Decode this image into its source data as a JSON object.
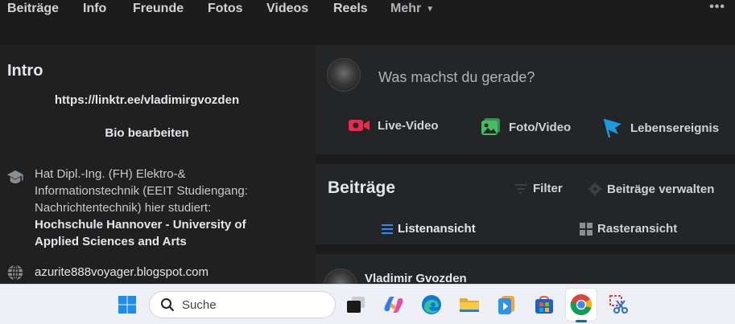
{
  "tabs": {
    "items": [
      "Beiträge",
      "Info",
      "Freunde",
      "Fotos",
      "Videos",
      "Reels"
    ],
    "more_label": "Mehr",
    "more_icon": "caret-down-icon",
    "options_icon": "more-options-icon"
  },
  "intro": {
    "title": "Intro",
    "link": "https://linktr.ee/vladimirgvozden",
    "edit_bio_label": "Bio bearbeiten",
    "education_prefix": "Hat Dipl.-Ing. (FH) Elektro-& Informationstechnik (EEIT Studiengang: Nachrichtentechnik) hier studiert:",
    "education_school": "Hochschule Hannover - University of Applied Sciences and Arts",
    "education_icon": "graduation-cap-icon",
    "website": "azurite888voyager.blogspot.com",
    "website_icon": "globe-icon"
  },
  "composer": {
    "prompt": "Was machst du gerade?",
    "actions": {
      "live_video": "Live-Video",
      "photo_video": "Foto/Video",
      "life_event": "Lebensereignis"
    },
    "icons": [
      "live-video-icon",
      "photo-video-icon",
      "life-event-flag-icon"
    ],
    "colors": {
      "live": "#f02849",
      "photo": "#45bd62",
      "event": "#1b9bde"
    }
  },
  "posts": {
    "title": "Beiträge",
    "filter_label": "Filter",
    "manage_label": "Beiträge verwalten",
    "list_view_label": "Listenansicht",
    "grid_view_label": "Rasteransicht",
    "accent_color": "#2d88ff"
  },
  "post": {
    "author": "Vladimir Gvozden"
  },
  "taskbar": {
    "search_placeholder": "Suche",
    "apps": [
      "windows-start-icon",
      "task-view-icon",
      "copilot-icon",
      "edge-icon",
      "file-explorer-icon",
      "media-player-icon",
      "microsoft-store-icon",
      "chrome-icon",
      "snipping-tool-icon"
    ]
  }
}
